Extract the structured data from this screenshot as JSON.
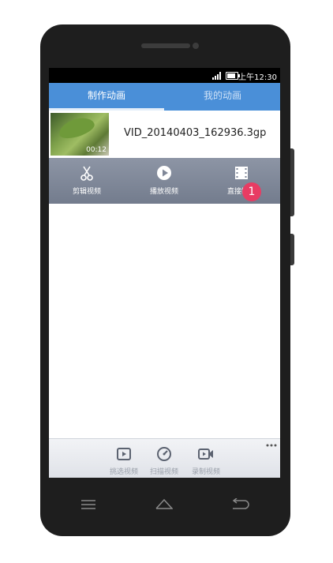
{
  "status_bar": {
    "time": "上午12:30",
    "battery_fraction": 0.8
  },
  "tabs": [
    {
      "label": "制作动画",
      "active": true
    },
    {
      "label": "我的动画",
      "active": false
    }
  ],
  "video": {
    "file_name": "VID_20140403_162936.3gp",
    "duration": "00:12"
  },
  "actions": [
    {
      "label": "剪辑视频",
      "icon": "scissors-icon"
    },
    {
      "label": "播放视频",
      "icon": "play-icon"
    },
    {
      "label": "直接制作",
      "icon": "film-icon"
    }
  ],
  "badge": {
    "count": "1",
    "color": "#e83c63"
  },
  "bottom_toolbar": [
    {
      "label": "挑选视频",
      "icon": "video-pick-icon"
    },
    {
      "label": "扫描视频",
      "icon": "scan-icon"
    },
    {
      "label": "录制视频",
      "icon": "camera-icon"
    }
  ],
  "colors": {
    "accent": "#4a8fd8",
    "action_bar": "#7f8798"
  },
  "system_nav": [
    "menu-icon",
    "home-icon",
    "back-icon"
  ]
}
